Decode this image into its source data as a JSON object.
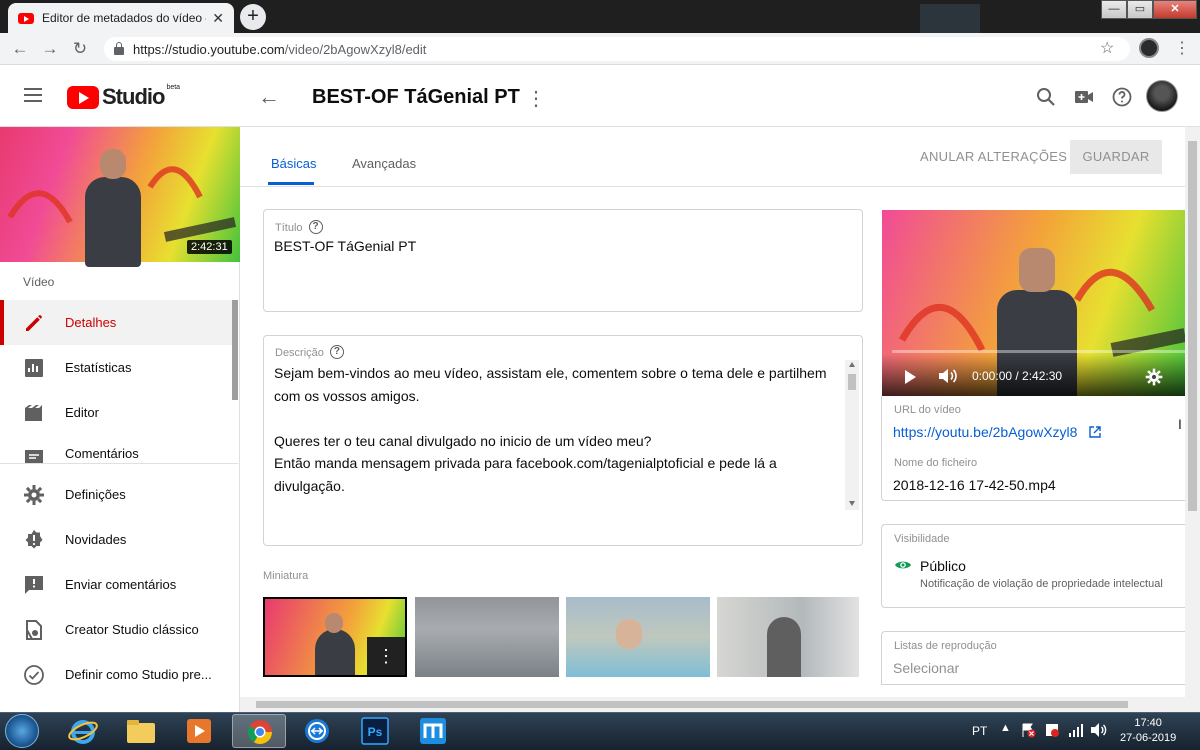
{
  "browser": {
    "tab_title": "Editor de metadados do vídeo –",
    "tab_close": "✕",
    "new_tab": "+",
    "url_host": "https://studio.youtube.com",
    "url_path": "/video/2bAgowXzyl8/edit",
    "window_min": "—",
    "window_max": "▭",
    "window_close": "✕"
  },
  "header": {
    "logo_text": "Studio",
    "logo_badge": "beta",
    "video_title": "BEST-OF TáGenial PT",
    "icons": [
      "menu-icon",
      "back-arrow-icon",
      "more-vert-icon",
      "search-icon",
      "create-video-icon",
      "help-icon",
      "avatar"
    ]
  },
  "sidebar": {
    "thumb_duration": "2:42:31",
    "section_label": "Vídeo",
    "items": [
      {
        "label": "Detalhes",
        "icon": "pencil-icon",
        "active": true
      },
      {
        "label": "Estatísticas",
        "icon": "analytics-icon"
      },
      {
        "label": "Editor",
        "icon": "film-icon"
      },
      {
        "label": "Comentários",
        "icon": "comment-icon"
      }
    ],
    "bottom_items": [
      {
        "label": "Definições",
        "icon": "gear-icon"
      },
      {
        "label": "Novidades",
        "icon": "alert-badge-icon"
      },
      {
        "label": "Enviar comentários",
        "icon": "feedback-icon"
      },
      {
        "label": "Creator Studio clássico",
        "icon": "classic-studio-icon"
      },
      {
        "label": "Definir como Studio pre...",
        "icon": "check-circle-icon"
      }
    ]
  },
  "tabs": {
    "basic": "Básicas",
    "advanced": "Avançadas",
    "discard": "ANULAR ALTERAÇÕES",
    "save": "GUARDAR"
  },
  "form": {
    "title_label": "Título",
    "title_value": "BEST-OF TáGenial PT",
    "description_label": "Descrição",
    "description_lines": [
      "Sejam bem-vindos ao meu vídeo, assistam ele, comentem sobre o tema dele e partilhem",
      "com os vossos amigos.",
      "",
      "Queres ter o teu canal divulgado no inicio de um vídeo meu?",
      "Então manda mensagem privada para facebook.com/tagenialptoficial e pede lá a",
      "divulgação."
    ],
    "thumbnail_label": "Miniatura",
    "thumbnail_more": "⋮"
  },
  "player": {
    "time": "0:00:00 / 2:42:30"
  },
  "details": {
    "url_label": "URL do vídeo",
    "url_value": "https://youtu.be/2bAgowXzyl8",
    "file_label": "Nome do ficheiro",
    "file_value": "2018-12-16 17-42-50.mp4",
    "visibility_label": "Visibilidade",
    "visibility_value": "Público",
    "visibility_note": "Notificação de violação de propriedade intelectual",
    "playlists_label": "Listas de reprodução",
    "playlists_value": "Selecionar"
  },
  "taskbar": {
    "language": "PT",
    "time": "17:40",
    "date": "27-06-2019",
    "apps": [
      "internet-explorer-icon",
      "file-explorer-icon",
      "media-player-icon",
      "chrome-icon",
      "teamviewer-icon",
      "photoshop-icon",
      "maxthon-icon"
    ]
  },
  "colors": {
    "accent_blue": "#065fd4",
    "active_red": "#cc0000",
    "youtube_red": "#ff0000",
    "visibility_green": "#0f9d58"
  }
}
